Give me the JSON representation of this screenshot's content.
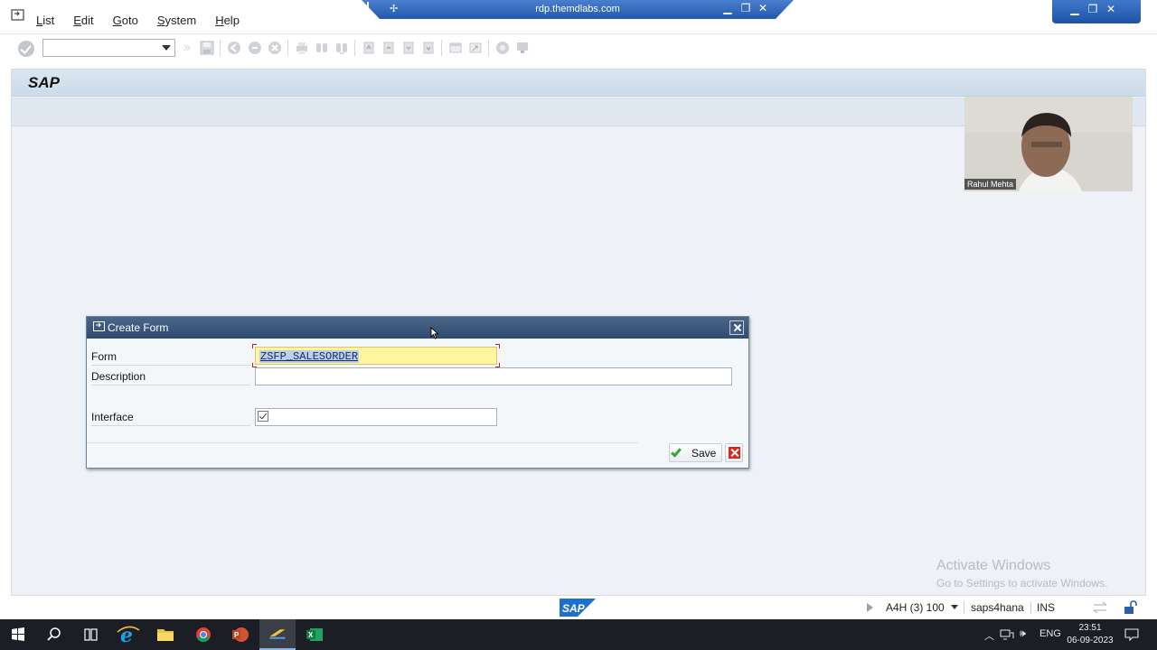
{
  "menubar": {
    "items": [
      "List",
      "Edit",
      "Goto",
      "System",
      "Help"
    ],
    "mnemonics": [
      "L",
      "E",
      "G",
      "S",
      "H"
    ]
  },
  "rdp": {
    "host": "rdp.themdlabs.com"
  },
  "toolbar": {
    "command_field_value": ""
  },
  "screen": {
    "title": "SAP"
  },
  "video": {
    "participant": "Rahul Mehta"
  },
  "dialog": {
    "title": "Create Form",
    "fields": {
      "form_label": "Form",
      "form_value": "ZSFP_SALESORDER",
      "description_label": "Description",
      "description_value": "",
      "interface_label": "Interface",
      "interface_value": ""
    },
    "buttons": {
      "save": "Save"
    }
  },
  "watermark": {
    "line1": "Activate Windows",
    "line2": "Go to Settings to activate Windows."
  },
  "statusbar": {
    "system": "A4H (3) 100",
    "server": "saps4hana",
    "mode": "INS"
  },
  "taskbar": {
    "lang": "ENG",
    "time": "23:51",
    "date": "06-09-2023"
  },
  "colors": {
    "dialog_title": "#2e4a6e",
    "focused_field": "#fff59c",
    "save_check": "#31a635",
    "cancel": "#d9251d"
  }
}
